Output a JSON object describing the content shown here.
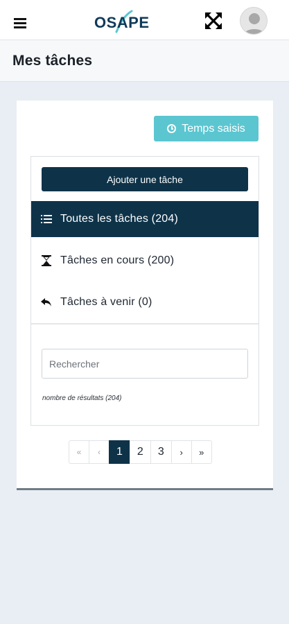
{
  "header": {
    "logo_text": "OSAPE",
    "menu_icon": "hamburger-icon",
    "fullscreen_icon": "expand-arrows-icon",
    "avatar_icon": "user-avatar-icon"
  },
  "page": {
    "title": "Mes tâches"
  },
  "toolbar": {
    "temps_label": "Temps saisis",
    "temps_icon": "clock-icon"
  },
  "tasks": {
    "add_label": "Ajouter une tâche",
    "filters": [
      {
        "label": "Toutes les tâches (204)",
        "icon": "list-icon",
        "active": true
      },
      {
        "label": "Tâches en cours (200)",
        "icon": "hourglass-icon",
        "active": false
      },
      {
        "label": "Tâches à venir (0)",
        "icon": "reply-arrow-icon",
        "active": false
      }
    ],
    "search_placeholder": "Rechercher",
    "results_text": "nombre de résultats (204)"
  },
  "pagination": {
    "first": "«",
    "prev": "‹",
    "pages": [
      "1",
      "2",
      "3"
    ],
    "current": "1",
    "next": "›",
    "last": "»"
  },
  "colors": {
    "primary_dark": "#0e3349",
    "accent_cyan": "#5bc6d0",
    "background": "#e9eef4"
  }
}
